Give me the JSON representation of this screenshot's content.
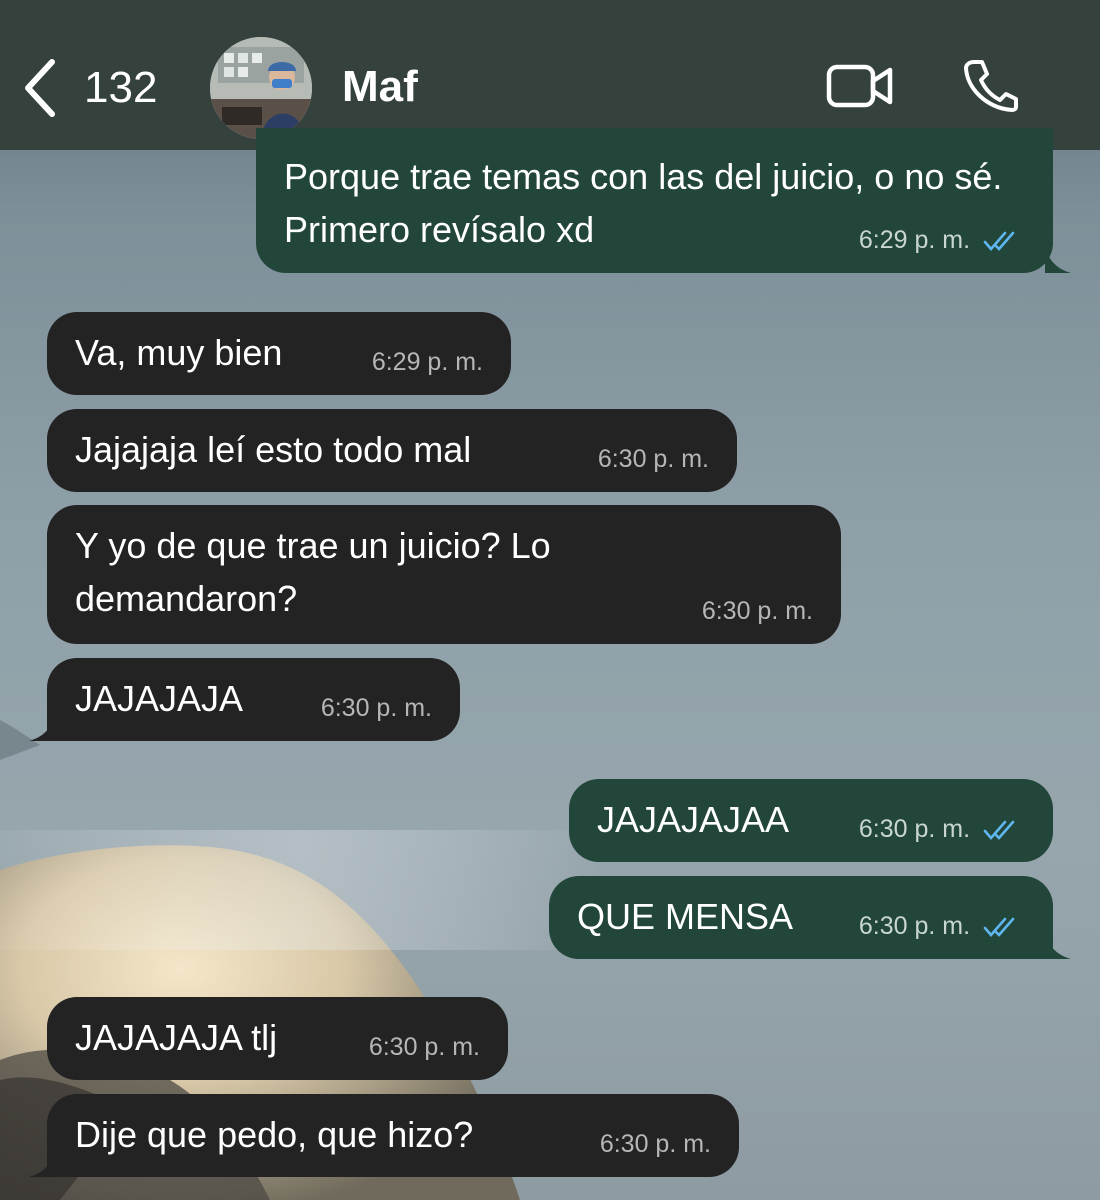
{
  "header": {
    "back_count": "132",
    "contact_name": "Maf"
  },
  "messages": [
    {
      "direction": "out",
      "text": "Porque trae temas con las del juicio, o no sé. Primero revísalo xd",
      "time": "6:29 p. m.",
      "read": true
    },
    {
      "direction": "in",
      "text": "Va, muy bien",
      "time": "6:29 p. m."
    },
    {
      "direction": "in",
      "text": "Jajajaja leí esto todo mal",
      "time": "6:30 p. m."
    },
    {
      "direction": "in",
      "text": "Y yo de que trae un juicio? Lo demandaron?",
      "time": "6:30 p. m."
    },
    {
      "direction": "in",
      "text": "JAJAJAJA",
      "time": "6:30 p. m."
    },
    {
      "direction": "out",
      "text": "JAJAJAJAA",
      "time": "6:30 p. m.",
      "read": true
    },
    {
      "direction": "out",
      "text": "QUE MENSA",
      "time": "6:30 p. m.",
      "read": true
    },
    {
      "direction": "in",
      "text": "JAJAJAJA tlj",
      "time": "6:30 p. m."
    },
    {
      "direction": "in",
      "text": "Dije que pedo, que hizo?",
      "time": "6:30 p. m."
    }
  ],
  "colors": {
    "header_bg": "#34413d",
    "incoming_bubble": "#232323",
    "outgoing_bubble": "#22463a",
    "read_tick": "#5fb7f0"
  },
  "icons": {
    "back": "chevron-left-icon",
    "video": "video-camera-icon",
    "phone": "phone-icon",
    "read": "double-check-icon"
  }
}
